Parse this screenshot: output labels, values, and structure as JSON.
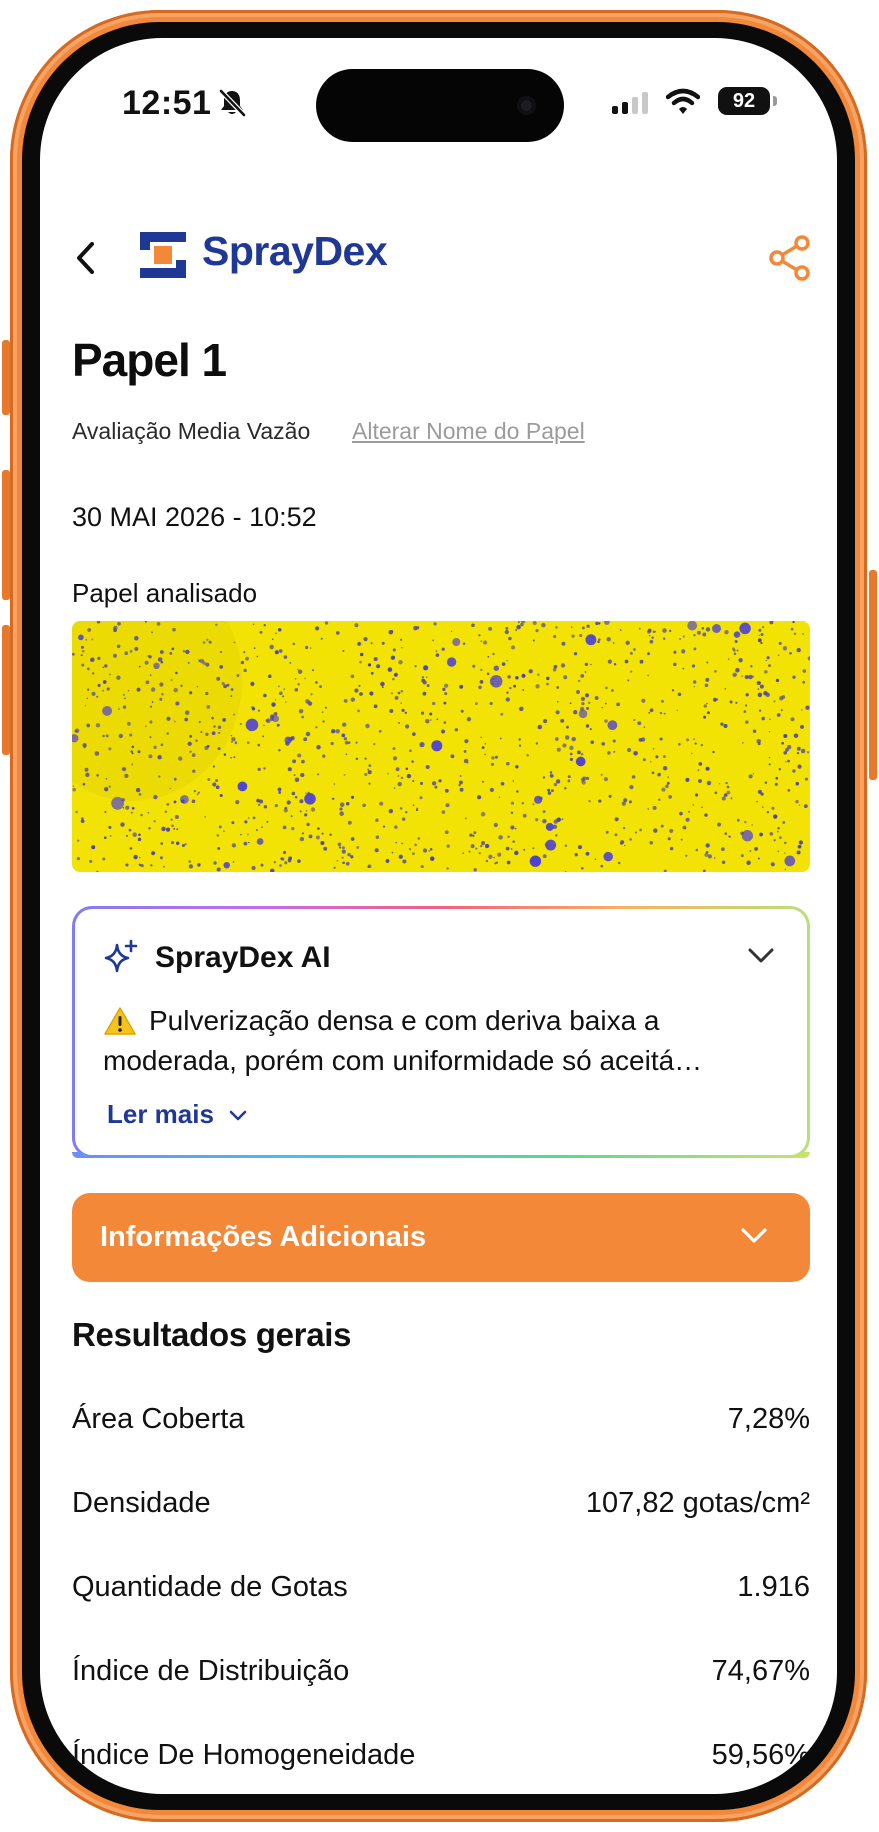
{
  "status_bar": {
    "time": "12:51",
    "battery": "92"
  },
  "header": {
    "brand": "SprayDex",
    "brand_color": "#1f3896",
    "accent_color": "#f38839",
    "back_icon": "chevron-left-icon",
    "share_icon": "share-icon"
  },
  "page": {
    "title": "Papel 1",
    "subtitle": "Avaliação Media Vazão",
    "rename_link": "Alterar Nome do Papel",
    "date": "30 MAI 2026 - 10:52",
    "analyzed_label": "Papel analisado"
  },
  "ai_card": {
    "title": "SprayDex AI",
    "warning_icon": "warning-icon",
    "summary": "Pulverização densa e com deriva baixa a moderada, porém com uniformidade só aceitá…",
    "read_more": "Ler mais"
  },
  "info_section": {
    "label": "Informações Adicionais"
  },
  "results": {
    "title": "Resultados gerais",
    "rows": [
      {
        "label": "Área Coberta",
        "value": "7,28%"
      },
      {
        "label": "Densidade",
        "value": "107,82 gotas/cm²"
      },
      {
        "label": "Quantidade de Gotas",
        "value": "1.916"
      },
      {
        "label": "Índice de Distribuição",
        "value": "74,67%"
      },
      {
        "label": "Índice De Homogeneidade",
        "value": "59,56%"
      }
    ]
  }
}
